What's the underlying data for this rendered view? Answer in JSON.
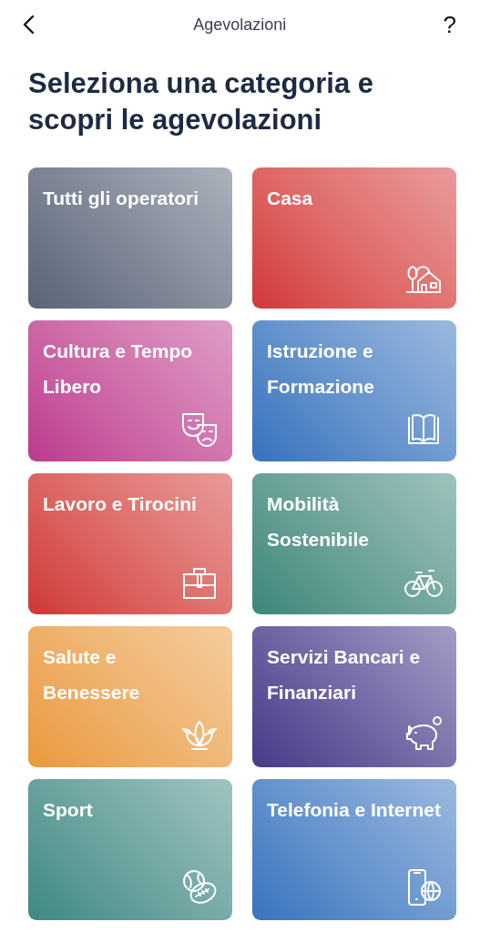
{
  "header": {
    "title": "Agevolazioni",
    "help": "?"
  },
  "heading": "Seleziona una categoria e scopri le agevolazioni",
  "categories": [
    {
      "label": "Tutti gli operatori",
      "kind": "all",
      "color": "#5a6478"
    },
    {
      "label": "Casa",
      "kind": "house",
      "color": "#d2373a"
    },
    {
      "label": "Cultura e Tempo Libero",
      "kind": "masks",
      "color": "#bd3a8e"
    },
    {
      "label": "Istruzione e Formazione",
      "kind": "book",
      "color": "#3673bd"
    },
    {
      "label": "Lavoro e Tirocini",
      "kind": "briefcase",
      "color": "#cf3636"
    },
    {
      "label": "Mobilità Sostenibile",
      "kind": "bicycle",
      "color": "#3d877b"
    },
    {
      "label": "Salute e Benessere",
      "kind": "lotus",
      "color": "#e99a3a"
    },
    {
      "label": "Servizi Bancari e Finanziari",
      "kind": "piggy",
      "color": "#483a88"
    },
    {
      "label": "Sport",
      "kind": "ball",
      "color": "#3e8984"
    },
    {
      "label": "Telefonia e Internet",
      "kind": "phone",
      "color": "#3874be"
    }
  ]
}
